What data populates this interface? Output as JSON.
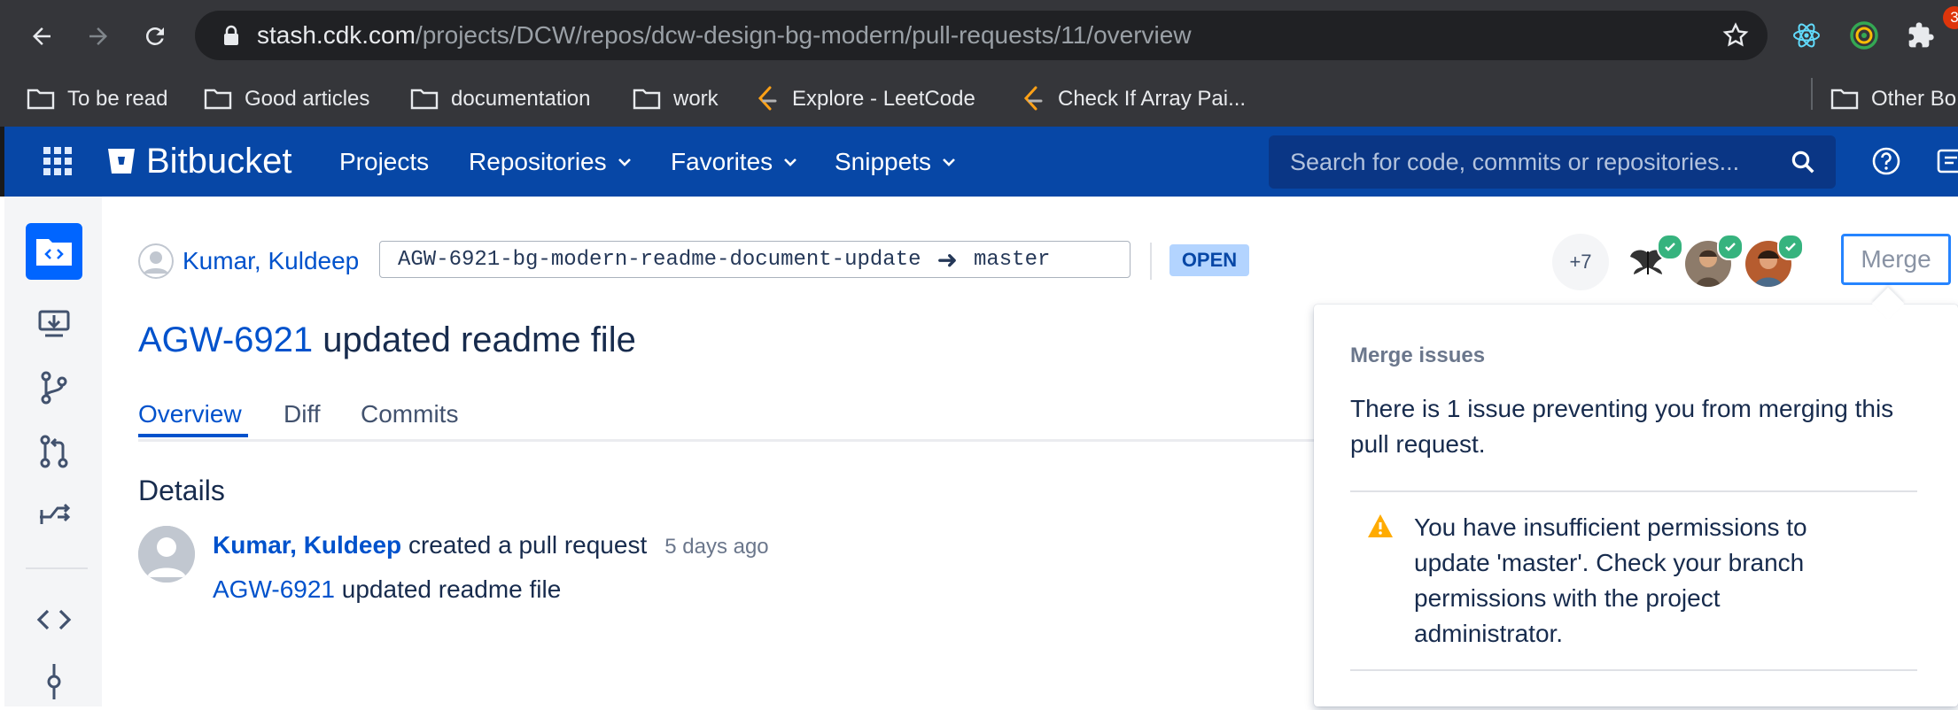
{
  "browser": {
    "url_host": "stash.cdk.com",
    "url_path": "/projects/DCW/repos/dcw-design-bg-modern/pull-requests/11/overview",
    "bookmarks": [
      {
        "label": "To be read",
        "icon": "folder-icon"
      },
      {
        "label": "Good articles",
        "icon": "folder-icon"
      },
      {
        "label": "documentation",
        "icon": "folder-icon"
      },
      {
        "label": "work",
        "icon": "folder-icon"
      },
      {
        "label": "Explore - LeetCode",
        "icon": "leetcode-icon"
      },
      {
        "label": "Check If Array Pai...",
        "icon": "leetcode-icon"
      },
      {
        "label": "Other Bo",
        "icon": "folder-icon"
      }
    ]
  },
  "header": {
    "brand": "Bitbucket",
    "nav": [
      "Projects",
      "Repositories",
      "Favorites",
      "Snippets"
    ],
    "search_placeholder": "Search for code, commits or repositories...",
    "notification_count": "3"
  },
  "pr": {
    "author": "Kumar, Kuldeep",
    "source_branch": "AGW-6921-bg-modern-readme-document-update",
    "arrow": "➜",
    "target_branch": "master",
    "status": "OPEN",
    "reviewers_more": "+7",
    "merge_label": "Merge",
    "title_key": "AGW-6921",
    "title_text": " updated readme file",
    "tabs": [
      "Overview",
      "Diff",
      "Commits"
    ]
  },
  "details": {
    "heading": "Details",
    "activity_author": "Kumar, Kuldeep",
    "activity_action": " created a pull request",
    "activity_time": "5 days ago",
    "activity_key": "AGW-6921",
    "activity_text": " updated readme file"
  },
  "merge_popover": {
    "heading": "Merge issues",
    "summary": "There is 1 issue preventing you from merging this pull request.",
    "issue": "You have insufficient permissions to update 'master'. Check your branch permissions with the project administrator."
  },
  "colors": {
    "header_bg": "#0747a6",
    "link": "#0052cc",
    "status_bg": "#b3d4ff",
    "approved": "#36b37e",
    "warning": "#ffab00"
  }
}
